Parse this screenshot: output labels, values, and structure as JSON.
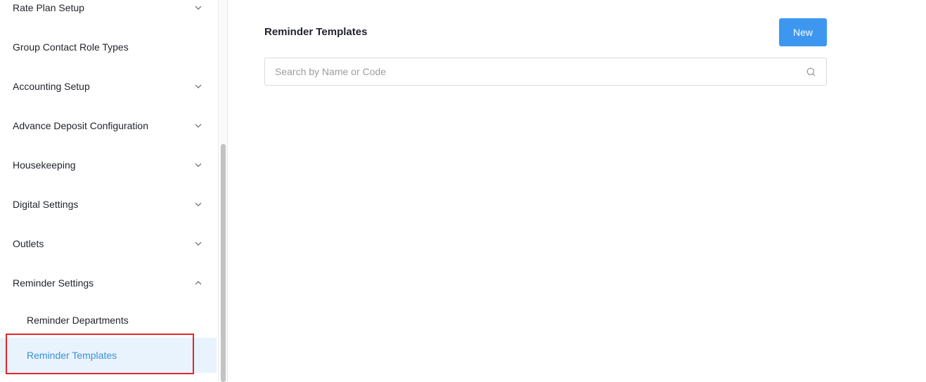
{
  "sidebar": {
    "items": [
      {
        "label": "Rate Plan Setup",
        "chevron": "chevron-down-icon"
      },
      {
        "label": "Group Contact Role Types",
        "chevron": ""
      },
      {
        "label": "Accounting Setup",
        "chevron": "chevron-down-icon"
      },
      {
        "label": "Advance Deposit Configuration",
        "chevron": "chevron-down-icon"
      },
      {
        "label": "Housekeeping",
        "chevron": "chevron-down-icon"
      },
      {
        "label": "Digital Settings",
        "chevron": "chevron-down-icon"
      },
      {
        "label": "Outlets",
        "chevron": "chevron-down-icon"
      },
      {
        "label": "Reminder Settings",
        "chevron": "chevron-up-icon"
      }
    ],
    "subitems": [
      {
        "label": "Reminder Departments",
        "active": false
      },
      {
        "label": "Reminder Templates",
        "active": true
      }
    ]
  },
  "main": {
    "title": "Reminder Templates",
    "new_button_label": "New",
    "search": {
      "placeholder": "Search by Name or Code",
      "value": ""
    }
  },
  "colors": {
    "accent": "#3d97f0",
    "active_bg": "#e8f3fd",
    "active_text": "#3b8fd8",
    "highlight_border": "#e3262a"
  }
}
